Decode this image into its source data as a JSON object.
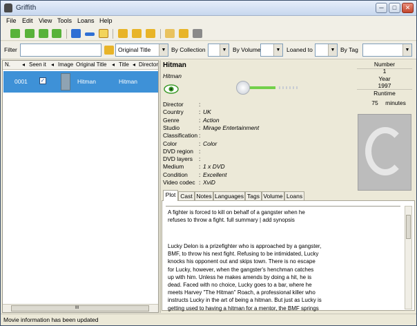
{
  "window": {
    "title": "Griffith",
    "minimize_label": "─",
    "maximize_label": "□",
    "close_label": "✕"
  },
  "menu": [
    "File",
    "Edit",
    "View",
    "Tools",
    "Loans",
    "Help"
  ],
  "toolbar": {
    "icons": [
      "first-icon",
      "previous-icon",
      "next-icon",
      "last-icon",
      "add-icon",
      "remove-icon",
      "edit-icon",
      "tool-1-icon",
      "tool-2-icon",
      "tool-3-icon",
      "open-folder-icon",
      "stamp-icon",
      "export-icon"
    ]
  },
  "filter": {
    "label": "Filter",
    "value": "",
    "field_select": "Original Title",
    "by_collection_label": "By Collection",
    "by_collection_value": "",
    "by_volume_label": "By Volume",
    "by_volume_value": "",
    "loaned_to_label": "Loaned to",
    "loaned_to_value": "",
    "by_tag_label": "By Tag",
    "by_tag_value": ""
  },
  "list": {
    "columns": [
      "N.",
      "Seen it",
      "Image",
      "Original Title",
      "Title",
      "Director"
    ],
    "rows": [
      {
        "number": "0001",
        "seen": "✓",
        "original_title": "Hitman",
        "title": "Hitman"
      }
    ],
    "scroll_label": "III"
  },
  "movie": {
    "title": "Hitman",
    "original_title": "Hitman",
    "fields": [
      {
        "key": "Director",
        "value": ""
      },
      {
        "key": "Country",
        "value": "UK"
      },
      {
        "key": "Genre",
        "value": "Action"
      },
      {
        "key": "Studio",
        "value": "Mirage Entertainment"
      },
      {
        "key": "Classification",
        "value": ""
      },
      {
        "key": "Color",
        "value": "Color"
      },
      {
        "key": "DVD region",
        "value": ""
      },
      {
        "key": "DVD layers",
        "value": ""
      },
      {
        "key": "Medium",
        "value": "1 x DVD"
      },
      {
        "key": "Condition",
        "value": "Excellent"
      },
      {
        "key": "Video codec",
        "value": "XviD"
      }
    ],
    "separator": ":",
    "number_label": "Number",
    "number": "1",
    "year_label": "Year",
    "year": "1997",
    "runtime_label": "Runtime",
    "runtime": "75",
    "runtime_unit": "minutes",
    "rating": 0.55
  },
  "tabs": [
    "Plot",
    "Cast",
    "Notes",
    "Languages",
    "Tags",
    "Volume",
    "Loans"
  ],
  "plot": {
    "summary": "A fighter is forced to kill on behalf of a gangster when he\nrefuses to throw a fight. full summary | add synopsis",
    "body": "Lucky Delon is a prizefighter who is approached by a gangster,\nBMF, to throw his next fight. Refusing to be intimidated, Lucky\nknocks his opponent out and skips town. There is no escape\nfor Lucky, however, when the gangster's henchman catches\nup with him. Unless he makes amends by doing a hit, he is\ndead. Faced with no choice, Lucky goes to a bar, where he\nmeets Harvey \"The Hitman\" Roach, a professional killer who\ninstructs Lucky in the art of being a hitman. But just as Lucky is\ngetting used to having a hitman for a mentor, the BMF springs\na new trap that results in a violent and bloody showdown."
  },
  "status": "Movie information has been updated"
}
